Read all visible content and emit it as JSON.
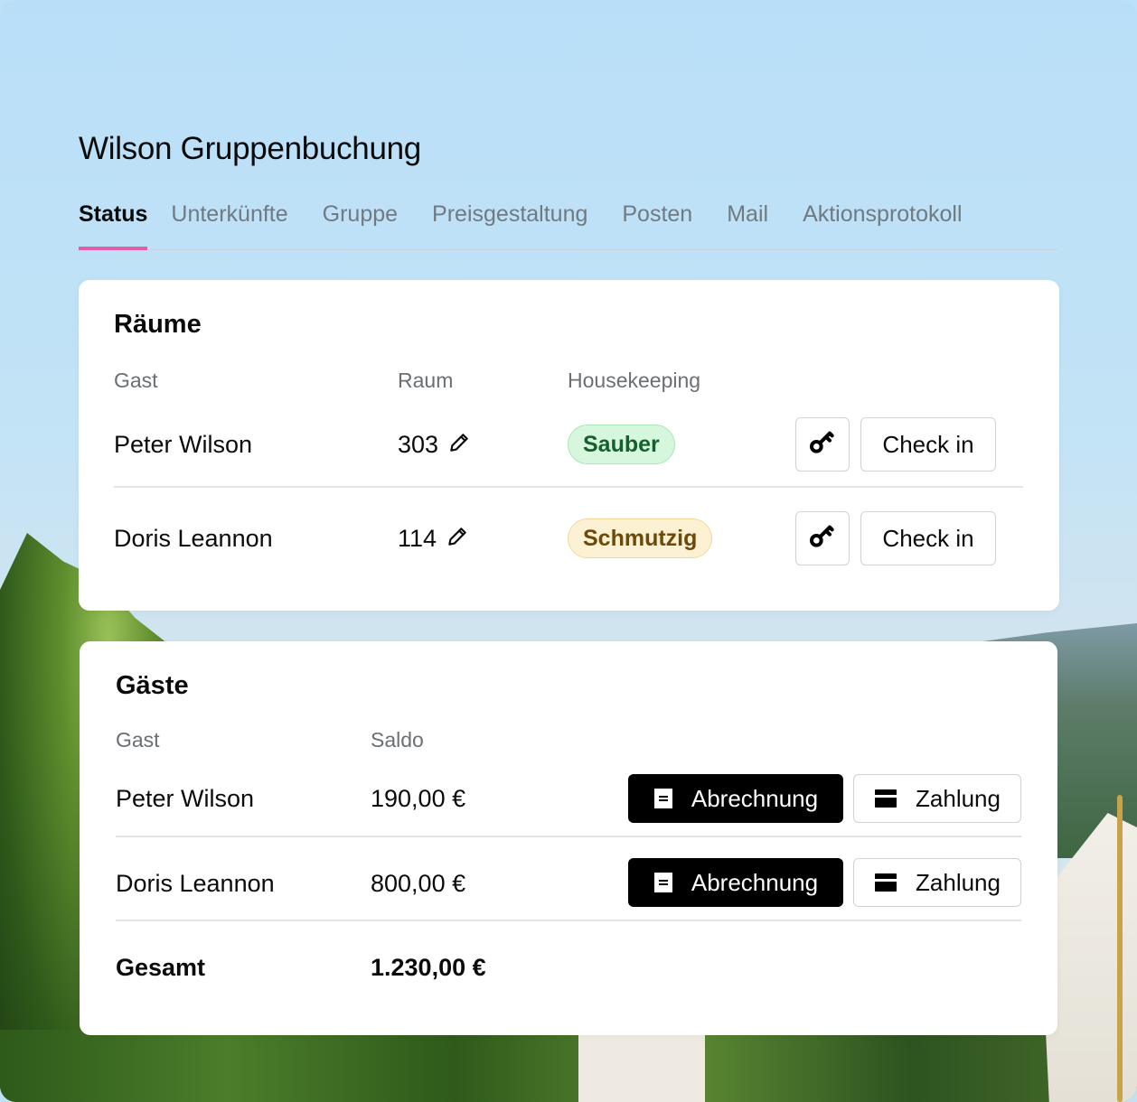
{
  "page": {
    "title": "Wilson Gruppenbuchung",
    "tabs": [
      "Status",
      "Unterkünfte",
      "Gruppe",
      "Preisgestaltung",
      "Posten",
      "Mail",
      "Aktionsprotokoll"
    ],
    "active_tab": "Status",
    "accent_color": "#e25ca7"
  },
  "rooms": {
    "title": "Räume",
    "headers": {
      "guest": "Gast",
      "room": "Raum",
      "housekeeping": "Housekeeping"
    },
    "rows": [
      {
        "guest": "Peter Wilson",
        "room": "303",
        "housekeeping": "Sauber",
        "status": "clean",
        "key_icon": "key-icon",
        "action": "Check in"
      },
      {
        "guest": "Doris Leannon",
        "room": "114",
        "housekeeping": "Schmutzig",
        "status": "dirty",
        "key_icon": "key-icon",
        "action": "Check in"
      }
    ]
  },
  "guests": {
    "title": "Gäste",
    "headers": {
      "guest": "Gast",
      "balance": "Saldo"
    },
    "rows": [
      {
        "guest": "Peter Wilson",
        "balance": "190,00 €",
        "invoice": "Abrechnung",
        "payment": "Zahlung"
      },
      {
        "guest": "Doris Leannon",
        "balance": "800,00 €",
        "invoice": "Abrechnung",
        "payment": "Zahlung"
      }
    ],
    "total_label": "Gesamt",
    "total_value": "1.230,00 €"
  }
}
